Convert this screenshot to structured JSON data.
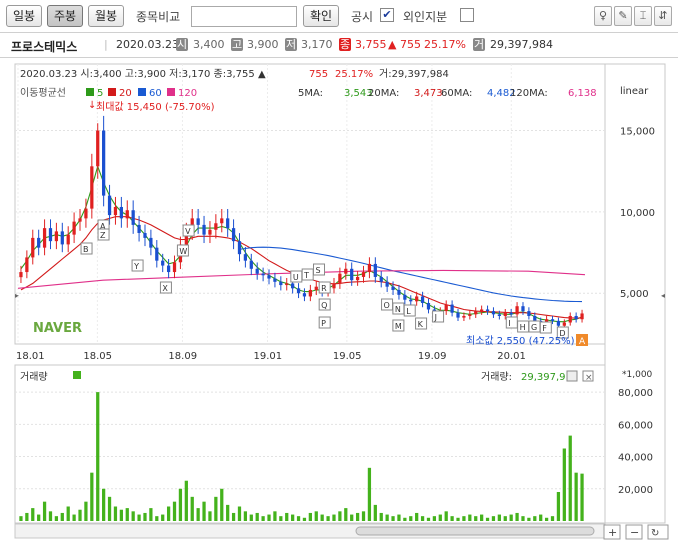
{
  "toolbar": {
    "daily_label": "일봉",
    "weekly_label": "주봉",
    "monthly_label": "월봉",
    "compare_label": "종목비교",
    "compare_value": "",
    "confirm_label": "확인",
    "disclosure_label": "공시",
    "foreign_label": "외인지분",
    "disclosure_checked": true,
    "foreign_checked": false
  },
  "info": {
    "name": "프로스테믹스",
    "date": "2020.03.23",
    "open": "3,400",
    "high": "3,900",
    "low": "3,170",
    "close": "3,755",
    "change": "▲ 755",
    "change_pct": "25.17%",
    "volume": "29,397,984"
  },
  "chart_header": {
    "line": "2020.03.23 시:3,400 고:3,900 저:3,170 종:3,755 ▲",
    "change": "755",
    "change_pct": "25.17%",
    "volume": "거:29,397,984",
    "ma_title": "이동평균선",
    "ma5": "5",
    "ma20": "20",
    "ma60": "60",
    "ma120": "120",
    "ma_vals": [
      {
        "label": "5MA:",
        "value": "3,543",
        "color": "#2e9a1a"
      },
      {
        "label": "20MA:",
        "value": "3,473",
        "color": "#d21a1a"
      },
      {
        "label": "60MA:",
        "value": "4,482",
        "color": "#1a5ad2"
      },
      {
        "label": "120MA:",
        "value": "6,138",
        "color": "#e0308a"
      }
    ],
    "scale_label": "linear",
    "max_label": "최대값 15,450 (-75.70%)",
    "min_label": "최소값 2,550 (47.25%)",
    "naver": "NAVER",
    "vol_title": "거래량",
    "vol_value_label": "거래량:",
    "vol_value": "29,397,9",
    "vol_unit": "*1,000"
  },
  "colors": {
    "up": "#e02020",
    "down": "#1a4fd0",
    "ma5": "#2e9a1a",
    "ma20": "#d21a1a",
    "ma60": "#1a5ad2",
    "ma120": "#e0308a",
    "volume": "#44b21c"
  },
  "chart_data": [
    {
      "type": "candlestick",
      "title": "프로스테믹스",
      "x": [
        "18.01",
        "18.05",
        "18.09",
        "19.01",
        "19.05",
        "19.09",
        "20.01"
      ],
      "y_ticks": [
        "15,000",
        "10,000",
        "5,000"
      ],
      "ylim": [
        2000,
        17000
      ],
      "max": 15450,
      "min": 2550,
      "close": [
        6300,
        7200,
        8400,
        7800,
        9000,
        8200,
        8800,
        8000,
        8600,
        9400,
        9600,
        10200,
        12800,
        15000,
        11000,
        9800,
        10300,
        9600,
        10100,
        9200,
        8700,
        8400,
        7800,
        7000,
        6700,
        6300,
        6900,
        8000,
        8800,
        9600,
        9200,
        8600,
        8900,
        9300,
        9600,
        9000,
        8200,
        7400,
        7000,
        6500,
        6200,
        6100,
        5900,
        5700,
        5500,
        5600,
        5300,
        5000,
        4800,
        5200,
        5400,
        5100,
        5300,
        5600,
        6200,
        6500,
        5800,
        6000,
        6300,
        6800,
        6000,
        5700,
        5400,
        5200,
        4900,
        4600,
        4500,
        4800,
        4400,
        4000,
        3700,
        3900,
        4300,
        3800,
        3500,
        3600,
        3700,
        3900,
        4000,
        3900,
        3700,
        3600,
        3800,
        3700,
        4200,
        3900,
        3600,
        3300,
        3100,
        3400,
        3300,
        3000,
        3200,
        3600,
        3400,
        3755
      ],
      "ma_series": [
        {
          "name": "5",
          "values": [
            6500,
            7000,
            7600,
            8000,
            8400,
            8500,
            8600,
            8500,
            8600,
            9000,
            9500,
            10300,
            11500,
            12800,
            11800,
            11000,
            10400,
            10000,
            9800,
            9400,
            9000,
            8600,
            8100,
            7600,
            7200,
            6800,
            6900,
            7300,
            7900,
            8600,
            9000,
            9000,
            9000,
            9000,
            9100,
            9000,
            8700,
            8100,
            7500,
            7000,
            6600,
            6300,
            6100,
            5900,
            5700,
            5600,
            5450,
            5200,
            5100,
            5100,
            5200,
            5200,
            5300,
            5500,
            5800,
            6100,
            6100,
            6100,
            6200,
            6400,
            6200,
            6000,
            5700,
            5400,
            5100,
            4850,
            4650,
            4600,
            4500,
            4300,
            4100,
            3950,
            3950,
            3900,
            3800,
            3750,
            3700,
            3750,
            3800,
            3850,
            3800,
            3750,
            3700,
            3700,
            3800,
            3850,
            3750,
            3550,
            3400,
            3350,
            3300,
            3250,
            3250,
            3350,
            3400,
            3543
          ]
        },
        {
          "name": "20",
          "values": [
            5200,
            5400,
            5600,
            5900,
            6200,
            6500,
            6800,
            7100,
            7400,
            7700,
            8000,
            8400,
            8900,
            9300,
            9500,
            9600,
            9700,
            9700,
            9700,
            9600,
            9500,
            9350,
            9200,
            9000,
            8800,
            8600,
            8400,
            8300,
            8300,
            8400,
            8500,
            8500,
            8500,
            8500,
            8450,
            8400,
            8300,
            8150,
            7950,
            7750,
            7500,
            7250,
            7000,
            6800,
            6600,
            6400,
            6250,
            6100,
            5950,
            5850,
            5750,
            5650,
            5600,
            5580,
            5600,
            5650,
            5680,
            5700,
            5720,
            5750,
            5750,
            5700,
            5650,
            5550,
            5450,
            5300,
            5150,
            5000,
            4850,
            4700,
            4550,
            4400,
            4300,
            4200,
            4100,
            4000,
            3950,
            3900,
            3880,
            3860,
            3850,
            3840,
            3820,
            3800,
            3800,
            3800,
            3780,
            3740,
            3690,
            3640,
            3600,
            3550,
            3500,
            3480,
            3470,
            3473
          ]
        },
        {
          "name": "60",
          "values": [
            null,
            null,
            null,
            null,
            null,
            null,
            null,
            null,
            null,
            null,
            null,
            null,
            null,
            null,
            null,
            null,
            null,
            null,
            null,
            null,
            null,
            null,
            null,
            null,
            null,
            null,
            null,
            null,
            null,
            null,
            null,
            null,
            null,
            null,
            null,
            null,
            null,
            7700,
            7750,
            7800,
            7820,
            7830,
            7820,
            7800,
            7770,
            7730,
            7680,
            7620,
            7560,
            7500,
            7440,
            7380,
            7310,
            7240,
            7160,
            7080,
            7000,
            6920,
            6830,
            6740,
            6650,
            6560,
            6470,
            6380,
            6300,
            6220,
            6140,
            6060,
            5980,
            5900,
            5820,
            5740,
            5660,
            5580,
            5500,
            5420,
            5340,
            5260,
            5180,
            5100,
            5020,
            4950,
            4890,
            4830,
            4780,
            4730,
            4690,
            4650,
            4610,
            4580,
            4550,
            4530,
            4510,
            4495,
            4488,
            4482
          ]
        },
        {
          "name": "120",
          "values": [
            null,
            null,
            null,
            null,
            null,
            null,
            null,
            null,
            null,
            null,
            null,
            null,
            null,
            null,
            null,
            null,
            null,
            null,
            null,
            null,
            null,
            null,
            null,
            null,
            null,
            null,
            null,
            null,
            null,
            null,
            null,
            null,
            null,
            null,
            null,
            null,
            null,
            null,
            null,
            null,
            null,
            null,
            null,
            null,
            null,
            null,
            null,
            null,
            null,
            null,
            null,
            null,
            null,
            null,
            null,
            null,
            null,
            null,
            null,
            null,
            null,
            null,
            null,
            null,
            null,
            null,
            null,
            null,
            null,
            null,
            null,
            null,
            null,
            null,
            null,
            null,
            null,
            null,
            null,
            null,
            null,
            null,
            null,
            null,
            null,
            null,
            null,
            null,
            null,
            null,
            null,
            null,
            null,
            null,
            null,
            6138
          ]
        }
      ]
    },
    {
      "type": "bar",
      "title": "거래량",
      "y_ticks": [
        "80,000",
        "60,000",
        "40,000",
        "20,000"
      ],
      "ylim": [
        0,
        90000
      ],
      "values": [
        3000,
        5000,
        8000,
        4000,
        12000,
        6000,
        3000,
        5000,
        9000,
        4000,
        7000,
        12000,
        30000,
        80000,
        20000,
        15000,
        9000,
        7000,
        8000,
        6000,
        4000,
        5000,
        8000,
        3000,
        4000,
        9000,
        12000,
        20000,
        25000,
        15000,
        8000,
        12000,
        6000,
        15000,
        20000,
        10000,
        5000,
        9000,
        6000,
        4000,
        5000,
        3000,
        4000,
        6000,
        3000,
        5000,
        4000,
        3000,
        2000,
        5000,
        6000,
        4000,
        3000,
        4000,
        6000,
        8000,
        4000,
        5000,
        6000,
        33000,
        10000,
        5000,
        4000,
        3000,
        4000,
        2000,
        3000,
        5000,
        3000,
        2000,
        3000,
        4000,
        6000,
        3000,
        2000,
        3000,
        4000,
        3000,
        4000,
        2000,
        3000,
        4000,
        3000,
        4000,
        5000,
        3000,
        2000,
        3000,
        4000,
        2000,
        3000,
        18000,
        45000,
        53000,
        30000,
        29398
      ]
    }
  ]
}
